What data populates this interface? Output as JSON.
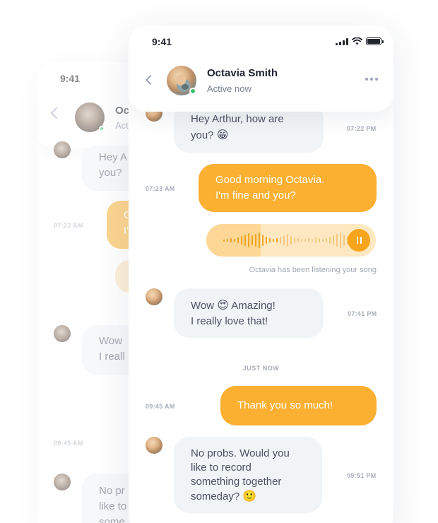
{
  "background_phone": {
    "time": "9:41",
    "contact_name_partial": "Oc",
    "status_partial": "Act",
    "msg1_partial_line1": "Hey A",
    "msg1_partial_line2": "you?",
    "ts_0723": "07:23 AM",
    "msg2_partial_line1": "G",
    "msg2_partial_line2": "I'",
    "msg3_partial_line1": "Wow",
    "msg3_partial_line2": "I reall",
    "ts_0945": "09:45 AM",
    "msg4_partial_line1": "No pr",
    "msg4_partial_line2": "like to",
    "msg4_partial_line3": "some"
  },
  "status_bar": {
    "time": "9:41",
    "icons": [
      "signal-icon",
      "wifi-icon",
      "battery-icon"
    ]
  },
  "header": {
    "back_icon": "chevron-left-icon",
    "contact_name": "Octavia Smith",
    "status": "Active now",
    "online": true,
    "more_icon": "more-horizontal-icon"
  },
  "messages": [
    {
      "direction": "in",
      "line1": "Hey Arthur, how are",
      "line2": "you?",
      "emoji": "😁",
      "time": "07:22 PM"
    },
    {
      "direction": "out",
      "line1": "Good morning Octavia.",
      "line2": "I'm fine and you?",
      "time": "07:23 AM"
    },
    {
      "direction": "in",
      "line1_pre": "Wow",
      "line1_emoji": "😍",
      "line1_post": "Amazing!",
      "line2": "I really love that!",
      "time": "07:41 PM"
    },
    {
      "direction": "out",
      "line1": "Thank you so much!",
      "time": "09:45 AM"
    },
    {
      "direction": "in",
      "line1": "No probs. Would you",
      "line2": "like to record",
      "line3": "something together",
      "line4": "someday?",
      "emoji": "🙂",
      "time": "09:51 PM"
    }
  ],
  "voice_message": {
    "progress": 0.32,
    "caption": "Octavia has been listening your song",
    "pause_icon": "pause-icon"
  },
  "divider": "JUST NOW",
  "colors": {
    "accent": "#fbb032",
    "accent_dark": "#f7a51c",
    "incoming_bubble": "#f1f4f6",
    "online": "#3cc36b"
  }
}
